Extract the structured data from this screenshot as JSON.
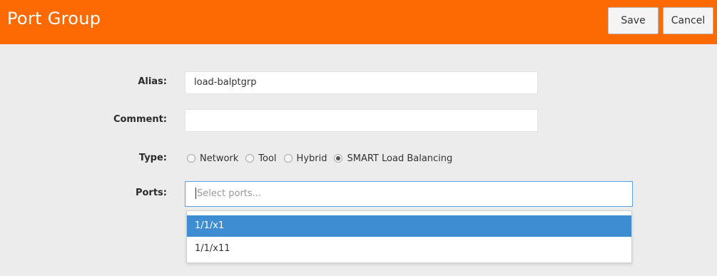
{
  "header": {
    "title": "Port Group",
    "save_label": "Save",
    "cancel_label": "Cancel"
  },
  "form": {
    "alias": {
      "label": "Alias:",
      "value": "load-balptgrp"
    },
    "comment": {
      "label": "Comment:",
      "value": ""
    },
    "type": {
      "label": "Type:",
      "options": [
        "Network",
        "Tool",
        "Hybrid",
        "SMART Load Balancing"
      ],
      "selected": "SMART Load Balancing"
    },
    "ports": {
      "label": "Ports:",
      "placeholder": "Select ports...",
      "options": [
        "1/1/x1",
        "1/1/x11"
      ],
      "highlighted": "1/1/x1"
    }
  },
  "colors": {
    "header_bg": "#fd6a02",
    "highlight": "#3e8dd2",
    "focus_border": "#57a3e6"
  }
}
